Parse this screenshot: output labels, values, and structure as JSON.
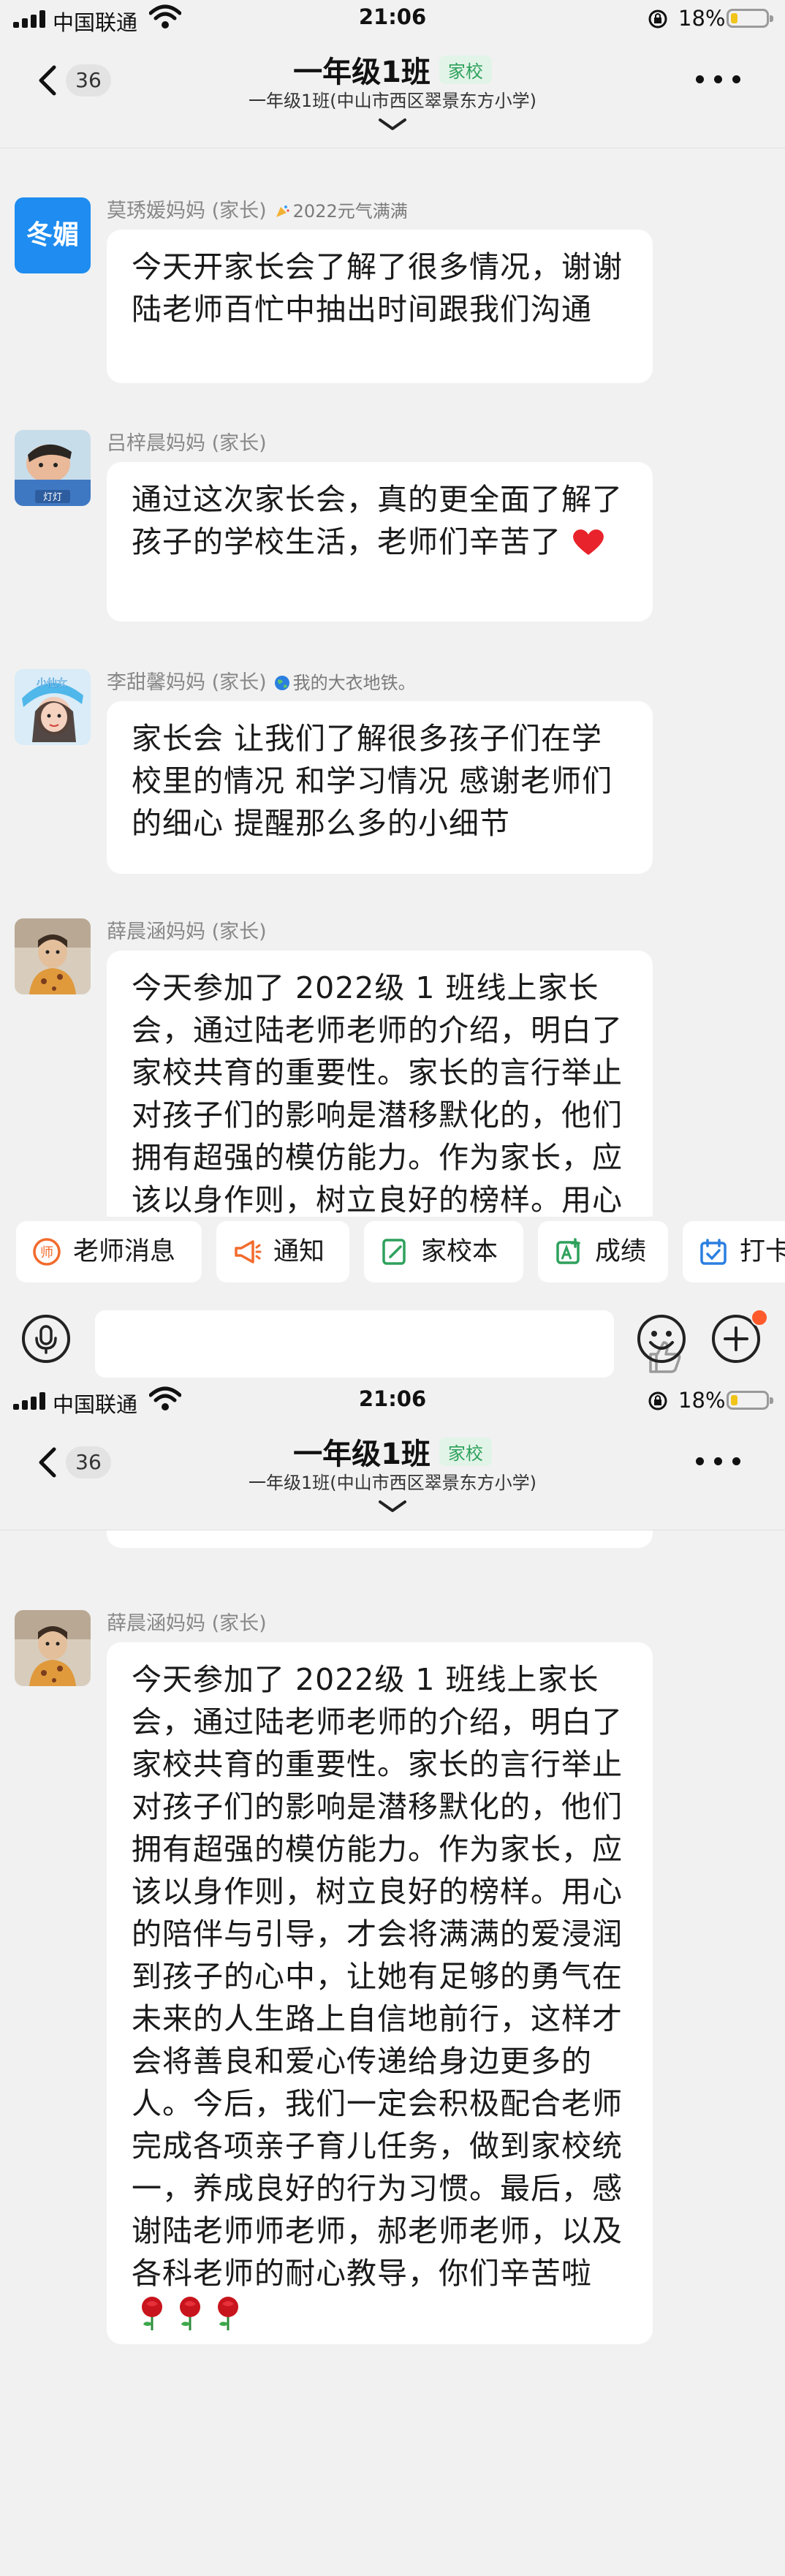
{
  "status_bar": {
    "carrier": "中国联通",
    "time": "21:06",
    "battery": "18%"
  },
  "nav": {
    "back_count": "36",
    "title": "一年级1班",
    "tag": "家校",
    "subtitle": "一年级1班(中山市西区翠景东方小学)"
  },
  "messages": [
    {
      "avatar_text": "冬媚",
      "sender": "莫琇媛妈妈 (家长)",
      "extra": "2022元气满满",
      "text": "今天开家长会了解了很多情况，谢谢陆老师百忙中抽出时间跟我们沟通"
    },
    {
      "avatar_label": "灯灯",
      "sender": "吕梓晨妈妈 (家长)",
      "extra": "",
      "text": "通过这次家长会，真的更全面了解了孩子的学校生活，老师们辛苦了"
    },
    {
      "avatar_label": "小仙女",
      "sender": "李甜馨妈妈 (家长)",
      "extra": "我的大衣地铁。",
      "text": "家长会 让我们了解很多孩子们在学校里的情况 和学习情况 感谢老师们的细心 提醒那么多的小细节"
    },
    {
      "sender": "薛晨涵妈妈 (家长)",
      "extra": "",
      "text": "今天参加了 2022级 1 班线上家长会，通过陆老师老师的介绍，明白了家校共育的重要性。家长的言行举止对孩子们的影响是潜移默化的，他们拥有超强的模仿能力。作为家长，应该以身作则，树立良好的榜样。用心的陪伴与引导，才会将满满的爱浸润到孩子的心中，让她有足够的勇气在未来的人生路上自信地前行，这样才会将善良和爱心传递给身边更多的人。今后，我们一定会积极配合老师完成各项亲子育儿任务，做到家校统一，养成良好的行为习惯。最后，感谢陆老师师老师，郝老师老师，以及各科老师的耐心教导，你们辛苦啦"
    }
  ],
  "quick_actions": [
    {
      "label": "老师消息",
      "icon": "teacher-icon"
    },
    {
      "label": "通知",
      "icon": "megaphone-icon"
    },
    {
      "label": "家校本",
      "icon": "notebook-icon"
    },
    {
      "label": "成绩",
      "icon": "grade-icon"
    },
    {
      "label": "打卡",
      "icon": "checkin-icon"
    }
  ],
  "colors": {
    "tag_green": "#2ea15c",
    "avatar_blue": "#1e8cf0",
    "badge_orange": "#ff5a2c"
  }
}
